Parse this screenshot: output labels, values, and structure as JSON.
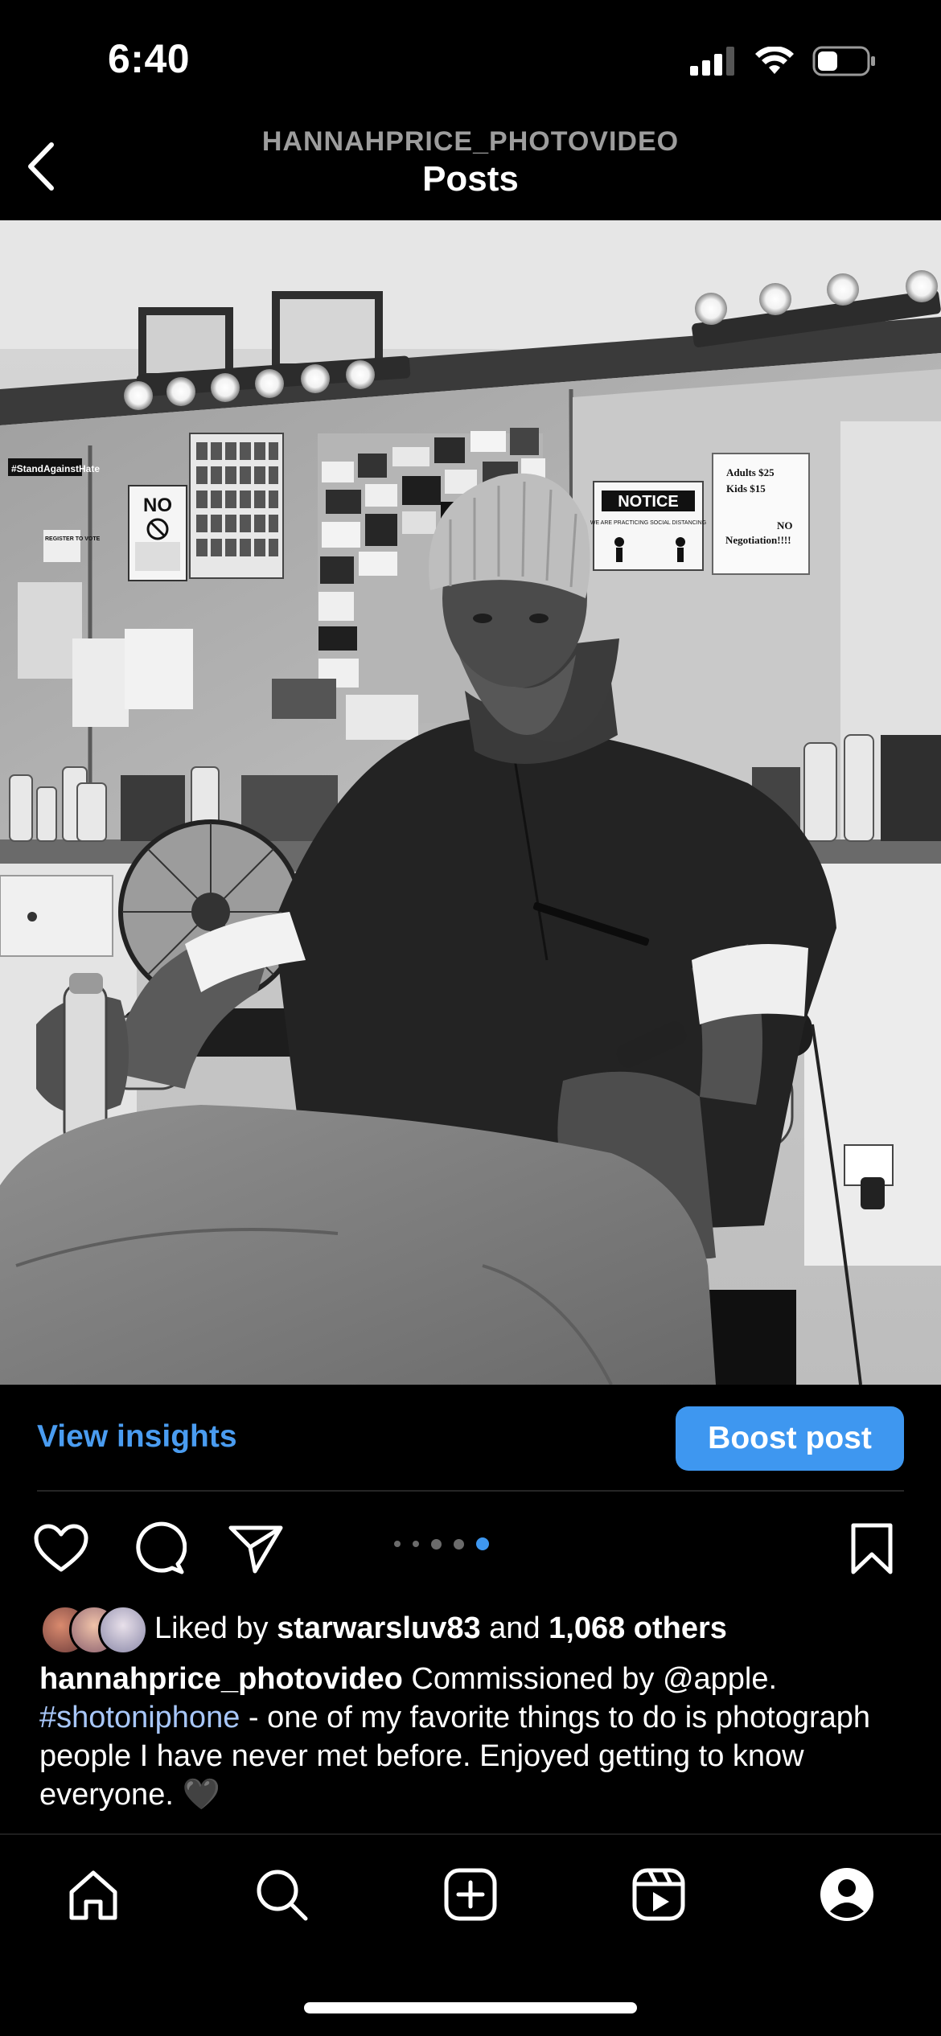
{
  "status_bar": {
    "time": "6:40",
    "icons": [
      "cellular-signal-icon",
      "wifi-icon",
      "battery-icon"
    ]
  },
  "header": {
    "username": "HANNAHPRICE_PHOTOVIDEO",
    "title": "Posts",
    "back_icon": "chevron-left-icon"
  },
  "photo": {
    "scene_signs": {
      "notice": "NOTICE",
      "notice_sub": "WE ARE PRACTICING SOCIAL DISTANCING",
      "no": "NO",
      "price_line1": "Adults $25",
      "price_line2": "Kids $15",
      "price_line3": "NO",
      "price_line4": "Negotiation!!!!",
      "hashtag_sign": "#StandAgainstHate",
      "register_sign": "REGISTER TO VOTE"
    }
  },
  "insights": {
    "view_insights_label": "View insights",
    "boost_label": "Boost post"
  },
  "actions": {
    "icons": [
      "heart-icon",
      "comment-icon",
      "share-icon",
      "bookmark-icon"
    ],
    "carousel": {
      "total": 5,
      "active_index": 4
    }
  },
  "likes": {
    "prefix": "Liked by",
    "user": "starwarsluv83",
    "connector": "and",
    "others": "1,068 others"
  },
  "caption": {
    "author": "hannahprice_photovideo",
    "text_part1": "Commissioned by @apple.",
    "hashtag": "#shotoniphone",
    "text_part2": "- one of my favorite things to do is photograph people I have never met before. Enjoyed getting to know everyone.",
    "emoji": "🖤"
  },
  "bottom_nav": {
    "items": [
      "home-icon",
      "search-icon",
      "create-icon",
      "reels-icon",
      "profile-icon"
    ]
  },
  "colors": {
    "accent_link": "#4a9cf0",
    "boost_button": "#3e97f0",
    "hashtag": "#a8c7fa",
    "background": "#000000",
    "active_dot": "#3e97f0"
  }
}
